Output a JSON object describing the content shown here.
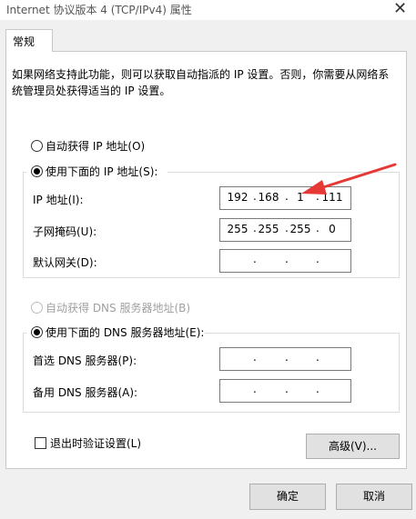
{
  "window": {
    "title": "Internet 协议版本 4 (TCP/IPv4) 属性",
    "close_glyph": "✕"
  },
  "tabs": [
    {
      "label": "常规"
    }
  ],
  "general": {
    "description": "如果网络支持此功能，则可以获取自动指派的 IP 设置。否则，你需要从网络系统管理员处获得适当的 IP 设置。",
    "ip_mode": {
      "auto_label": "自动获得 IP 地址(O)",
      "manual_label": "使用下面的 IP 地址(S):",
      "selected": "manual"
    },
    "ip_fields": [
      {
        "label": "IP 地址(I):",
        "octets": [
          "192",
          "168",
          "1",
          "111"
        ]
      },
      {
        "label": "子网掩码(U):",
        "octets": [
          "255",
          "255",
          "255",
          "0"
        ]
      },
      {
        "label": "默认网关(D):",
        "octets": [
          "",
          "",
          "",
          ""
        ]
      }
    ],
    "dns_mode": {
      "auto_label": "自动获得 DNS 服务器地址(B)",
      "manual_label": "使用下面的 DNS 服务器地址(E):",
      "selected": "manual",
      "auto_disabled": true
    },
    "dns_fields": [
      {
        "label": "首选 DNS 服务器(P):",
        "octets": [
          "",
          "",
          "",
          ""
        ]
      },
      {
        "label": "备用 DNS 服务器(A):",
        "octets": [
          "",
          "",
          "",
          ""
        ]
      }
    ],
    "validate_on_exit": {
      "label": "退出时验证设置(L)",
      "checked": false
    },
    "advanced_button": "高级(V)..."
  },
  "footer": {
    "ok_button": "确定",
    "cancel_button": "取消"
  },
  "colors": {
    "window_bg": "#f0f0f0",
    "panel_bg": "#ffffff",
    "annotation_arrow": "#e53935"
  },
  "dot_separator": "."
}
